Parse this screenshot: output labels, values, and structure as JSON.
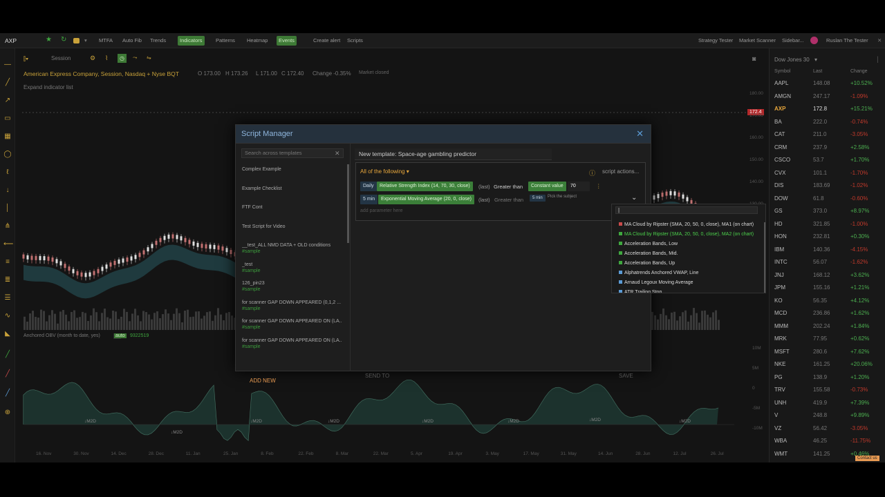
{
  "topbar": {
    "symbol": "AXP",
    "mtfa": "MTFA",
    "autofib": "Auto Fib",
    "trends": "Trends",
    "indicators": "Indicators",
    "patterns": "Patterns",
    "heatmap": "Heatmap",
    "events": "Events",
    "create_alert": "Create alert",
    "scripts": "Scripts",
    "strategy_tester": "Strategy Tester",
    "market_scanner": "Market Scanner",
    "sidebar": "Sidebar...",
    "user": "Ruslan The Tester"
  },
  "chart": {
    "session": "Session",
    "company": "American Express Company, Session, Nasdaq + Nyse BQT",
    "o": "O 173.00",
    "h": "H 173.26",
    "l": "L 171.00",
    "c": "C 172.40",
    "change": "Change -0.35%",
    "status": "Market closed",
    "expand": "Expand indicator list",
    "last_price": "172.4",
    "obv_label": "Anchored OBV (month to date, yes)",
    "obv_value": "9322519",
    "price_ticks": [
      "180.00",
      "170.00",
      "160.00",
      "150.00",
      "140.00",
      "130.00",
      "120.00",
      "110.00",
      "100.00",
      "90.00"
    ],
    "obv_ticks": [
      "10M",
      "5M",
      "0",
      "-5M",
      "-10M"
    ],
    "dates": [
      "16. Nov",
      "30. Nov",
      "14. Dec",
      "28. Dec",
      "11. Jan",
      "25. Jan",
      "8. Feb",
      "22. Feb",
      "8. Mar",
      "22. Mar",
      "5. Apr",
      "19. Apr",
      "3. May",
      "17. May",
      "31. May",
      "14. Jun",
      "28. Jun",
      "12. Jul",
      "26. Jul"
    ],
    "m2d": "M2D"
  },
  "watchlist": {
    "title": "Dow Jones 30",
    "col_symbol": "Symbol",
    "col_last": "Last",
    "col_change": "Change",
    "footer": "Contact us",
    "rows": [
      {
        "s": "AAPL",
        "l": "148.08",
        "c": "+10.52%",
        "p": true
      },
      {
        "s": "AMGN",
        "l": "247.17",
        "c": "-1.09%",
        "p": false
      },
      {
        "s": "AXP",
        "l": "172.8",
        "c": "+15.21%",
        "p": true
      },
      {
        "s": "BA",
        "l": "222.0",
        "c": "-0.74%",
        "p": false
      },
      {
        "s": "CAT",
        "l": "211.0",
        "c": "-3.05%",
        "p": false
      },
      {
        "s": "CRM",
        "l": "237.9",
        "c": "+2.58%",
        "p": true
      },
      {
        "s": "CSCO",
        "l": "53.7",
        "c": "+1.70%",
        "p": true
      },
      {
        "s": "CVX",
        "l": "101.1",
        "c": "-1.70%",
        "p": false
      },
      {
        "s": "DIS",
        "l": "183.69",
        "c": "-1.02%",
        "p": false
      },
      {
        "s": "DOW",
        "l": "61.8",
        "c": "-0.60%",
        "p": false
      },
      {
        "s": "GS",
        "l": "373.0",
        "c": "+8.97%",
        "p": true
      },
      {
        "s": "HD",
        "l": "321.85",
        "c": "-1.00%",
        "p": false
      },
      {
        "s": "HON",
        "l": "232.81",
        "c": "+0.30%",
        "p": true
      },
      {
        "s": "IBM",
        "l": "140.36",
        "c": "-4.15%",
        "p": false
      },
      {
        "s": "INTC",
        "l": "56.07",
        "c": "-1.62%",
        "p": false
      },
      {
        "s": "JNJ",
        "l": "168.12",
        "c": "+3.62%",
        "p": true
      },
      {
        "s": "JPM",
        "l": "155.16",
        "c": "+1.21%",
        "p": true
      },
      {
        "s": "KO",
        "l": "56.35",
        "c": "+4.12%",
        "p": true
      },
      {
        "s": "MCD",
        "l": "236.86",
        "c": "+1.62%",
        "p": true
      },
      {
        "s": "MMM",
        "l": "202.24",
        "c": "+1.84%",
        "p": true
      },
      {
        "s": "MRK",
        "l": "77.95",
        "c": "+0.62%",
        "p": true
      },
      {
        "s": "MSFT",
        "l": "280.6",
        "c": "+7.62%",
        "p": true
      },
      {
        "s": "NKE",
        "l": "161.25",
        "c": "+20.06%",
        "p": true
      },
      {
        "s": "PG",
        "l": "138.9",
        "c": "+1.20%",
        "p": true
      },
      {
        "s": "TRV",
        "l": "155.58",
        "c": "-0.73%",
        "p": false
      },
      {
        "s": "UNH",
        "l": "419.9",
        "c": "+7.39%",
        "p": true
      },
      {
        "s": "V",
        "l": "248.8",
        "c": "+9.89%",
        "p": true
      },
      {
        "s": "VZ",
        "l": "56.42",
        "c": "-3.05%",
        "p": false
      },
      {
        "s": "WBA",
        "l": "46.25",
        "c": "-11.75%",
        "p": false
      },
      {
        "s": "WMT",
        "l": "141.25",
        "c": "+0.46%",
        "p": true
      }
    ]
  },
  "modal": {
    "title": "Script Manager",
    "search_placeholder": "Search across templates",
    "add_new": "ADD NEW",
    "send_to": "SEND TO",
    "save": "SAVE",
    "template_name": "New template: Space-age gambling predictor",
    "match_mode": "All of the following",
    "script_actions": "script actions...",
    "add_param": "add parameter here",
    "items": [
      {
        "name": "Complex Example",
        "tag": ""
      },
      {
        "name": "Example Checklist",
        "tag": ""
      },
      {
        "name": "FTF Cont",
        "tag": ""
      },
      {
        "name": "Test Script for Video",
        "tag": ""
      },
      {
        "name": "__test_ALL NMD DATA + OLD conditions",
        "tag": "#sample"
      },
      {
        "name": "_test",
        "tag": "#sample"
      },
      {
        "name": "126_pin23",
        "tag": "#sample"
      },
      {
        "name": "for scanner GAP DOWN APPEARED (0,1,2 ...",
        "tag": "#sample"
      },
      {
        "name": "for scanner GAP DOWN APPEARED ON (LA...",
        "tag": "#sample"
      },
      {
        "name": "for scanner GAP DOWN APPEARED ON (LA...",
        "tag": "#sample"
      }
    ],
    "cond1": {
      "tf": "Daily",
      "ind": "Relative Strength Index (14, 70, 30, close)",
      "last": "(last)",
      "op": "Greater than",
      "type": "Constant value",
      "val": "70"
    },
    "cond2": {
      "tf": "5 min",
      "ind": "Exponential Moving Average (20, 0, close)",
      "last": "(last)",
      "op": "Greater than",
      "tf2": "5 min",
      "subject": "Pick the subject"
    },
    "options": [
      {
        "t": "MA Cloud by Ripster (SMA, 20, 50, 0, close), MA1 (on chart)",
        "c": "#c94a4a",
        "hl": false
      },
      {
        "t": "MA Cloud by Ripster (SMA, 20, 50, 0, close), MA2 (on chart)",
        "c": "#3fa83f",
        "hl": true
      },
      {
        "t": "Acceleration Bands, Low",
        "c": "#3fa83f",
        "hl": false
      },
      {
        "t": "Acceleration Bands, Mid.",
        "c": "#3fa83f",
        "hl": false
      },
      {
        "t": "Acceleration Bands, Up",
        "c": "#3fa83f",
        "hl": false
      },
      {
        "t": "Alphatrends Anchored VWAP, Line",
        "c": "#5b9bd5",
        "hl": false
      },
      {
        "t": "Arnaud Legoux Moving Average",
        "c": "#5b9bd5",
        "hl": false
      },
      {
        "t": "ATR Trailing Stop",
        "c": "#5b9bd5",
        "hl": false
      }
    ]
  },
  "colors": {
    "accent": "#3e7a36",
    "link": "#8fb6dd",
    "orange": "#e89a52",
    "positive": "#4caf50",
    "negative": "#c0392b"
  }
}
